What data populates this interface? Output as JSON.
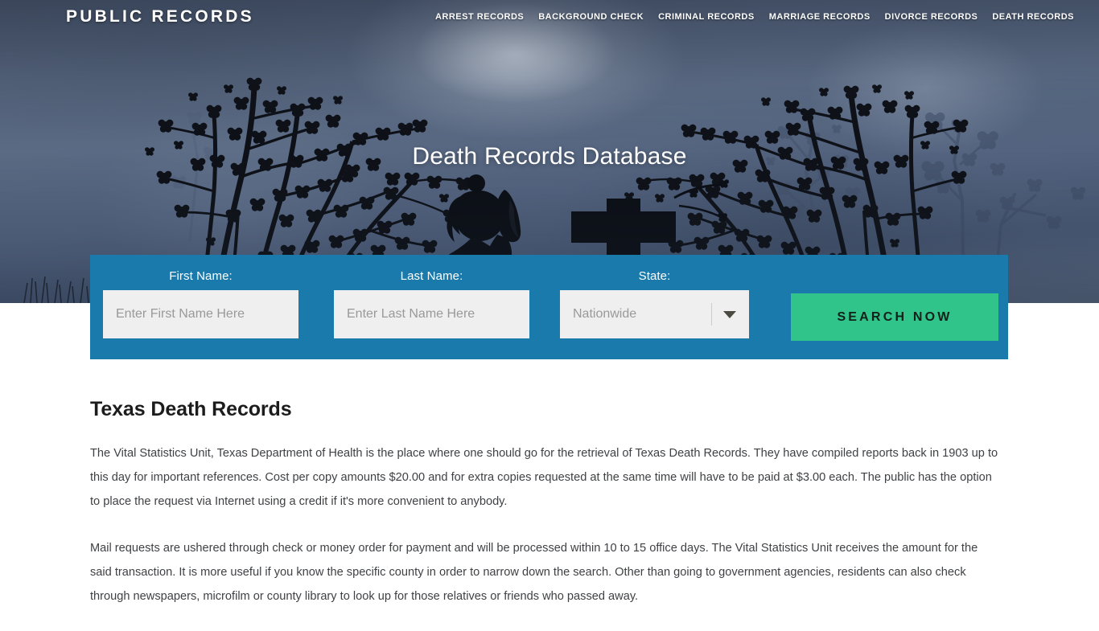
{
  "header": {
    "logo": "PUBLIC RECORDS",
    "nav": [
      {
        "label": "ARREST RECORDS"
      },
      {
        "label": "BACKGROUND CHECK"
      },
      {
        "label": "CRIMINAL RECORDS"
      },
      {
        "label": "MARRIAGE RECORDS"
      },
      {
        "label": "DIVORCE RECORDS"
      },
      {
        "label": "DEATH RECORDS"
      }
    ]
  },
  "hero": {
    "title": "Death Records Database",
    "background_description": "silhouetted blossom branches, praying girl and cross headstone against dusk sky",
    "sky_color": "#54627a",
    "silhouette_color": "#0d1016"
  },
  "search": {
    "panel_color": "#1b7aac",
    "first_name": {
      "label": "First Name:",
      "placeholder": "Enter First Name Here",
      "value": ""
    },
    "last_name": {
      "label": "Last Name:",
      "placeholder": "Enter Last Name Here",
      "value": ""
    },
    "state": {
      "label": "State:",
      "selected": "Nationwide",
      "arrow_icon": "chevron-down-icon"
    },
    "submit": {
      "label": "SEARCH NOW",
      "color": "#30c48a"
    }
  },
  "content": {
    "title": "Texas Death Records",
    "paragraphs": [
      "The Vital Statistics Unit, Texas Department of Health is the place where one should go for the retrieval of Texas Death Records. They have compiled reports back in 1903 up to this day for important references. Cost per copy amounts $20.00 and for extra copies requested at the same time will have to be paid at $3.00 each. The public has the option to place the request via Internet using a credit if it's more convenient to anybody.",
      "Mail requests are ushered through check or money order for payment and will be processed within 10 to 15 office days. The Vital Statistics Unit receives the amount for the said transaction. It is more useful if you know the specific county in order to narrow down the search. Other than going to government agencies, residents can also check through newspapers, microfilm or county library to look up for those relatives or friends who passed away."
    ]
  }
}
